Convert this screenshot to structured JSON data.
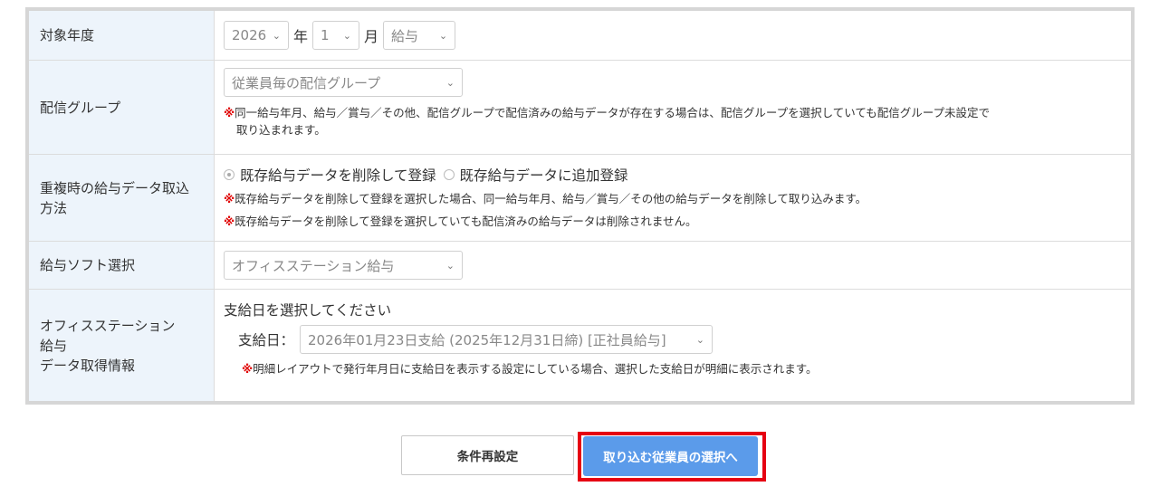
{
  "rows": {
    "year": {
      "label": "対象年度",
      "year_value": "2026",
      "year_unit": "年",
      "month_value": "1",
      "month_unit": "月",
      "type_value": "給与"
    },
    "group": {
      "label": "配信グループ",
      "placeholder": "従業員毎の配信グループ",
      "note_mark": "※",
      "note_line1": "同一給与年月、給与／賞与／その他、配信グループで配信済みの給与データが存在する場合は、配信グループを選択していても配信グループ未設定で",
      "note_line2": "取り込まれます。"
    },
    "duplicate": {
      "label": "重複時の給与データ取込方法",
      "option1": "既存給与データを削除して登録",
      "option2": "既存給与データに追加登録",
      "selected": "option1",
      "note_mark": "※",
      "note1": "既存給与データを削除して登録を選択した場合、同一給与年月、給与／賞与／その他の給与データを削除して取り込みます。",
      "note2": "既存給与データを削除して登録を選択していても配信済みの給与データは削除されません。"
    },
    "software": {
      "label": "給与ソフト選択",
      "value": "オフィスステーション給与"
    },
    "office": {
      "label_line1": "オフィスステーション",
      "label_line2": "給与",
      "label_line3": "データ取得情報",
      "prompt": "支給日を選択してください",
      "payday_label": "支給日：",
      "payday_value": "2026年01月23日支給 (2025年12月31日締) [正社員給与]",
      "note_mark": "※",
      "note": "明細レイアウトで発行年月日に支給日を表示する設定にしている場合、選択した支給日が明細に表示されます。"
    }
  },
  "buttons": {
    "reset": "条件再設定",
    "next": "取り込む従業員の選択へ"
  },
  "colors": {
    "label_bg": "#edf4fb",
    "primary": "#5b9bea",
    "highlight": "#e60012",
    "note_mark": "#e00000"
  }
}
